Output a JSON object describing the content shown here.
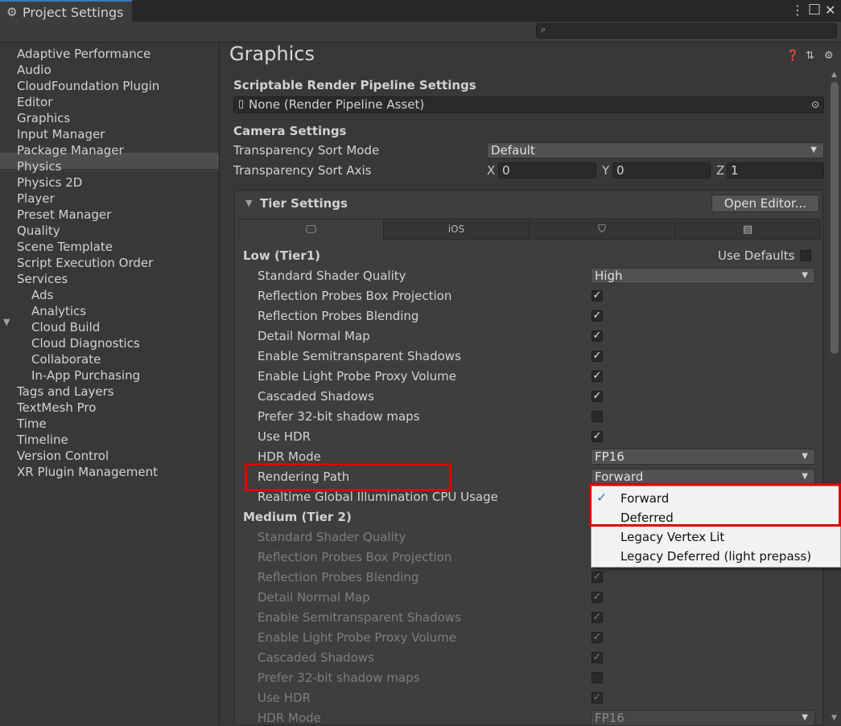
{
  "window": {
    "tab_title": "Project Settings",
    "gear_icon": "gear-icon",
    "menu_icon": "⋮",
    "maximize_icon": "□",
    "close_icon": "✕",
    "search_icon": "⌕"
  },
  "sidebar": {
    "items": [
      {
        "label": "Adaptive Performance"
      },
      {
        "label": "Audio"
      },
      {
        "label": "CloudFoundation Plugin"
      },
      {
        "label": "Editor"
      },
      {
        "label": "Graphics",
        "selected": true
      },
      {
        "label": "Input Manager"
      },
      {
        "label": "Package Manager"
      },
      {
        "label": "Physics"
      },
      {
        "label": "Physics 2D"
      },
      {
        "label": "Player"
      },
      {
        "label": "Preset Manager"
      },
      {
        "label": "Quality"
      },
      {
        "label": "Scene Template"
      },
      {
        "label": "Script Execution Order"
      },
      {
        "label": "Services",
        "expanded": true
      },
      {
        "label": "Ads",
        "child": true
      },
      {
        "label": "Analytics",
        "child": true
      },
      {
        "label": "Cloud Build",
        "child": true
      },
      {
        "label": "Cloud Diagnostics",
        "child": true
      },
      {
        "label": "Collaborate",
        "child": true
      },
      {
        "label": "In-App Purchasing",
        "child": true
      },
      {
        "label": "Tags and Layers"
      },
      {
        "label": "TextMesh Pro"
      },
      {
        "label": "Time"
      },
      {
        "label": "Timeline"
      },
      {
        "label": "Version Control"
      },
      {
        "label": "XR Plugin Management"
      }
    ],
    "fold_glyph": "▼"
  },
  "main": {
    "title": "Graphics",
    "srp": {
      "header": "Scriptable Render Pipeline Settings",
      "value": "None (Render Pipeline Asset)"
    },
    "camera": {
      "header": "Camera Settings",
      "sort_mode_label": "Transparency Sort Mode",
      "sort_mode_value": "Default",
      "sort_axis_label": "Transparency Sort Axis",
      "x_label": "X",
      "x_value": "0",
      "y_label": "Y",
      "y_value": "0",
      "z_label": "Z",
      "z_value": "1"
    },
    "tier": {
      "header": "Tier Settings",
      "open_editor": "Open Editor...",
      "tabs": [
        "",
        "iOS",
        "",
        ""
      ],
      "low": {
        "title": "Low (Tier1)",
        "use_defaults": "Use Defaults",
        "rows": [
          {
            "label": "Standard Shader Quality",
            "type": "popup",
            "value": "High"
          },
          {
            "label": "Reflection Probes Box Projection",
            "type": "check",
            "checked": true
          },
          {
            "label": "Reflection Probes Blending",
            "type": "check",
            "checked": true
          },
          {
            "label": "Detail Normal Map",
            "type": "check",
            "checked": true
          },
          {
            "label": "Enable Semitransparent Shadows",
            "type": "check",
            "checked": true
          },
          {
            "label": "Enable Light Probe Proxy Volume",
            "type": "check",
            "checked": true
          },
          {
            "label": "Cascaded Shadows",
            "type": "check",
            "checked": true
          },
          {
            "label": "Prefer 32-bit shadow maps",
            "type": "check",
            "checked": false
          },
          {
            "label": "Use HDR",
            "type": "check",
            "checked": true
          },
          {
            "label": "HDR Mode",
            "type": "popup",
            "value": "FP16"
          },
          {
            "label": "Rendering Path",
            "type": "popup",
            "value": "Forward"
          },
          {
            "label": "Realtime Global Illumination CPU Usage",
            "type": "none"
          }
        ]
      },
      "medium": {
        "title": "Medium (Tier 2)",
        "rows": [
          {
            "label": "Standard Shader Quality",
            "type": "none"
          },
          {
            "label": "Reflection Probes Box Projection",
            "type": "none"
          },
          {
            "label": "Reflection Probes Blending",
            "type": "check",
            "checked": true
          },
          {
            "label": "Detail Normal Map",
            "type": "check",
            "checked": true
          },
          {
            "label": "Enable Semitransparent Shadows",
            "type": "check",
            "checked": true
          },
          {
            "label": "Enable Light Probe Proxy Volume",
            "type": "check",
            "checked": true
          },
          {
            "label": "Cascaded Shadows",
            "type": "check",
            "checked": true
          },
          {
            "label": "Prefer 32-bit shadow maps",
            "type": "check",
            "checked": false
          },
          {
            "label": "Use HDR",
            "type": "check",
            "checked": true
          },
          {
            "label": "HDR Mode",
            "type": "popup",
            "value": "FP16"
          }
        ]
      }
    },
    "dropdown": {
      "options": [
        {
          "label": "Forward",
          "checked": true
        },
        {
          "label": "Deferred"
        },
        {
          "label": "Legacy Vertex Lit"
        },
        {
          "label": "Legacy Deferred (light prepass)"
        }
      ],
      "check_glyph": "✓"
    }
  },
  "colors": {
    "highlight": "#e00000",
    "accent": "#3a79bb"
  }
}
